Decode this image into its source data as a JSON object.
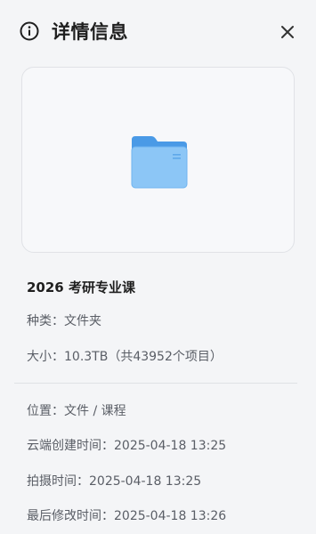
{
  "header": {
    "title": "详情信息",
    "info_icon": "info-circle-icon",
    "close_icon": "close-icon"
  },
  "preview": {
    "icon": "folder-icon",
    "folder_color": "#6fb4f0"
  },
  "file": {
    "name": "2026 考研专业课",
    "type_label": "种类：",
    "type_value": "文件夹",
    "size_label": "大小：",
    "size_value": "10.3TB（共43952个项目）"
  },
  "meta": {
    "location_label": "位置：",
    "location_value": "文件 / 课程",
    "cloud_created_label": "云端创建时间：",
    "cloud_created_value": "2025-04-18 13:25",
    "shot_label": "拍摄时间：",
    "shot_value": "2025-04-18 13:25",
    "modified_label": "最后修改时间：",
    "modified_value": "2025-04-18 13:26"
  }
}
